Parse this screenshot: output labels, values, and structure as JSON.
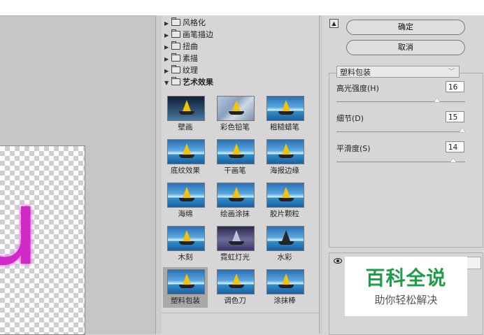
{
  "gallery": {
    "folders": [
      {
        "label": "风格化",
        "expanded": false
      },
      {
        "label": "画笔描边",
        "expanded": false
      },
      {
        "label": "扭曲",
        "expanded": false
      },
      {
        "label": "素描",
        "expanded": false
      },
      {
        "label": "纹理",
        "expanded": false
      },
      {
        "label": "艺术效果",
        "expanded": true
      }
    ],
    "filters": [
      {
        "label": "壁画",
        "style": "dark"
      },
      {
        "label": "彩色铅笔",
        "style": "pencil"
      },
      {
        "label": "粗糙蜡笔",
        "style": ""
      },
      {
        "label": "底纹效果",
        "style": ""
      },
      {
        "label": "干画笔",
        "style": ""
      },
      {
        "label": "海报边缘",
        "style": ""
      },
      {
        "label": "海绵",
        "style": ""
      },
      {
        "label": "绘画涂抹",
        "style": ""
      },
      {
        "label": "胶片颗粒",
        "style": ""
      },
      {
        "label": "木刻",
        "style": ""
      },
      {
        "label": "霓虹灯光",
        "style": "neon"
      },
      {
        "label": "水彩",
        "style": "wc"
      },
      {
        "label": "塑料包装",
        "style": "",
        "selected": true
      },
      {
        "label": "调色刀",
        "style": ""
      },
      {
        "label": "涂抹棒",
        "style": ""
      }
    ]
  },
  "preview": {
    "letter": "u",
    "letter_color": "#d128c8"
  },
  "panel": {
    "ok_label": "确定",
    "cancel_label": "取消",
    "filter_selected": "塑料包装",
    "params": [
      {
        "label": "高光强度(H)",
        "value": "16",
        "fraction": 0.8
      },
      {
        "label": "细节(D)",
        "value": "15",
        "fraction": 1.0
      },
      {
        "label": "平滑度(S)",
        "value": "14",
        "fraction": 0.93
      }
    ]
  },
  "watermark": {
    "title": "百科全说",
    "subtitle": "助你轻松解决",
    "color": "#1f9e4a"
  }
}
